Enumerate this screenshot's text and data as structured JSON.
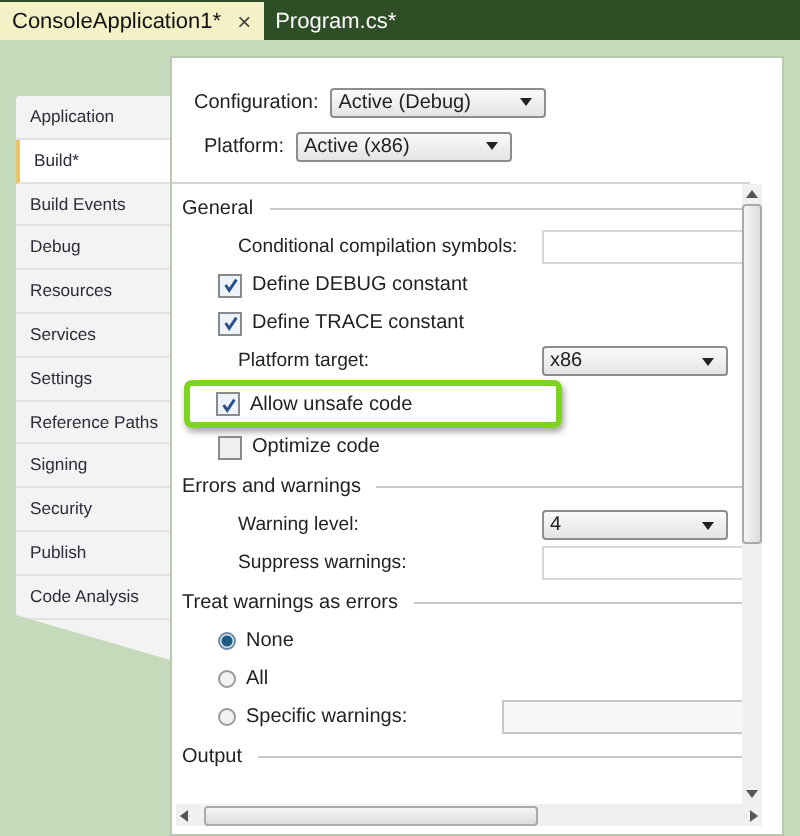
{
  "doc_tabs": [
    {
      "label": "ConsoleApplication1*",
      "selected": true,
      "close": "×"
    },
    {
      "label": "Program.cs*",
      "selected": false
    }
  ],
  "sidebar": {
    "items": [
      {
        "label": "Application",
        "selected": false
      },
      {
        "label": "Build*",
        "selected": true
      },
      {
        "label": "Build Events",
        "selected": false
      },
      {
        "label": "Debug",
        "selected": false
      },
      {
        "label": "Resources",
        "selected": false
      },
      {
        "label": "Services",
        "selected": false
      },
      {
        "label": "Settings",
        "selected": false
      },
      {
        "label": "Reference Paths",
        "selected": false
      },
      {
        "label": "Signing",
        "selected": false
      },
      {
        "label": "Security",
        "selected": false
      },
      {
        "label": "Publish",
        "selected": false
      },
      {
        "label": "Code Analysis",
        "selected": false
      }
    ]
  },
  "configuration": {
    "label": "Configuration:",
    "value": "Active (Debug)"
  },
  "platform": {
    "label": "Platform:",
    "value": "Active (x86)"
  },
  "sections": [
    {
      "title": "General",
      "rows": [
        {
          "kind": "field",
          "label": "Conditional compilation symbols:"
        },
        {
          "kind": "checkbox",
          "label": "Define DEBUG constant",
          "checked": true
        },
        {
          "kind": "checkbox",
          "label": "Define TRACE constant",
          "checked": true
        },
        {
          "kind": "dropdown",
          "label": "Platform target:",
          "value": "x86"
        },
        {
          "kind": "checkbox",
          "label": "Allow unsafe code",
          "checked": true,
          "highlighted": true
        },
        {
          "kind": "checkbox",
          "label": "Optimize code",
          "checked": false
        }
      ]
    },
    {
      "title": "Errors and warnings",
      "rows": [
        {
          "kind": "dropdown",
          "label": "Warning level:",
          "value": "4"
        },
        {
          "kind": "field",
          "label": "Suppress warnings:"
        }
      ]
    },
    {
      "title": "Treat warnings as errors",
      "rows": [
        {
          "kind": "radio",
          "label": "None",
          "selected": true
        },
        {
          "kind": "radio",
          "label": "All",
          "selected": false
        },
        {
          "kind": "radio-field",
          "label": "Specific warnings:",
          "selected": false,
          "disabled": true
        }
      ]
    },
    {
      "title": "Output"
    }
  ]
}
